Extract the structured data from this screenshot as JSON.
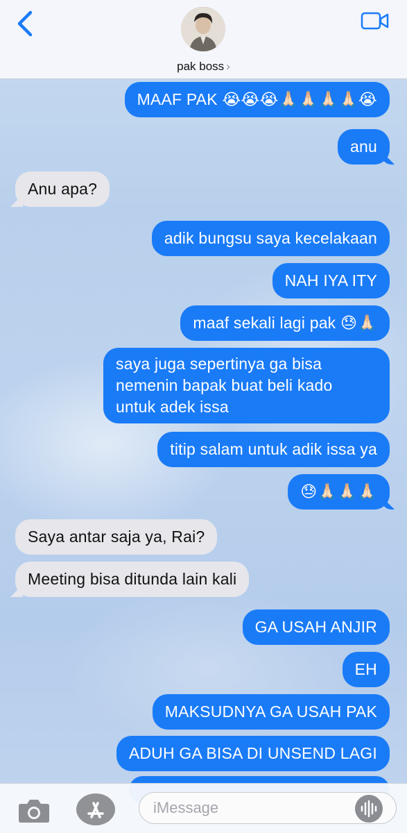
{
  "header": {
    "contact_name": "pak boss",
    "chevron": "›",
    "icons": {
      "back": "chevron-left-icon",
      "video": "video-camera-icon",
      "avatar": "contact-avatar"
    },
    "accent_color": "#1a7bf7"
  },
  "messages": [
    {
      "side": "sent",
      "text": "MAAF PAK 😭😭😭🙏🏻🙏🏻🙏🏻🙏🏻😭"
    },
    {
      "side": "sent",
      "text": "anu"
    },
    {
      "side": "received",
      "text": "Anu apa?"
    },
    {
      "side": "sent",
      "text": "adik bungsu saya kecelakaan"
    },
    {
      "side": "sent",
      "text": "NAH IYA ITY"
    },
    {
      "side": "sent",
      "text": "maaf sekali lagi pak 😓🙏🏻"
    },
    {
      "side": "sent",
      "lines": [
        "saya juga sepertinya ga bisa",
        "nemenin bapak buat beli kado",
        "untuk adek issa"
      ]
    },
    {
      "side": "sent",
      "text": "titip salam untuk adik issa ya"
    },
    {
      "side": "sent",
      "text": "😓🙏🏻🙏🏻🙏🏻"
    },
    {
      "side": "received",
      "text": "Saya antar saja ya, Rai?"
    },
    {
      "side": "received",
      "text": "Meeting bisa ditunda lain kali"
    },
    {
      "side": "sent",
      "text": "GA USAH ANJIR"
    },
    {
      "side": "sent",
      "text": "EH"
    },
    {
      "side": "sent",
      "text": "MAKSUDNYA GA USAH PAK"
    },
    {
      "side": "sent",
      "text": "ADUH GA BISA DI UNSEND LAGI"
    }
  ],
  "bubble_colors": {
    "sent": "#1a7bf7",
    "received": "#e6e6eb"
  },
  "composer": {
    "placeholder": "iMessage",
    "icons": {
      "camera": "camera-icon",
      "appstore": "app-store-icon",
      "voice": "audio-waveform-icon"
    }
  }
}
